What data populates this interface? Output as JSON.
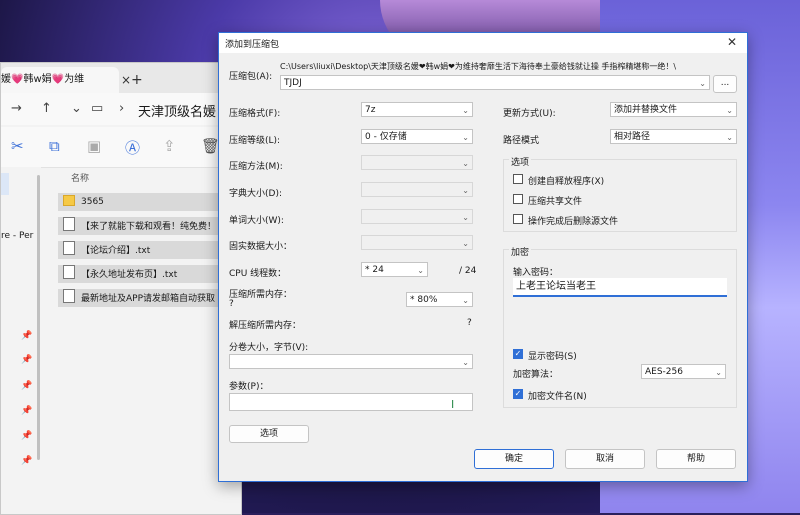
{
  "explorer": {
    "tab_title": "媛💗韩w娟💗为维",
    "path": "天津顶级名媛",
    "column_name": "名称",
    "side_label": "re - Per",
    "files": [
      {
        "name": "3565",
        "type": "folder"
      },
      {
        "name": "【来了就能下载和观看！纯免费！",
        "type": "file"
      },
      {
        "name": "【论坛介绍】.txt",
        "type": "file"
      },
      {
        "name": "【永久地址发布页】.txt",
        "type": "file"
      },
      {
        "name": "最新地址及APP请发邮箱自动获取",
        "type": "file"
      }
    ]
  },
  "dialog": {
    "title": "添加到压缩包",
    "archive_label": "压缩包(A):",
    "archive_path": "C:\\Users\\liuxi\\Desktop\\天津顶级名媛❤韩w娟❤为维持奢靡生活下海待奉土豪给钱就让操 手指榨精堪称一绝！\\",
    "archive_name": "TJDJ",
    "browse_label": "...",
    "format_label": "压缩格式(F):",
    "format_value": "7z",
    "level_label": "压缩等级(L):",
    "level_value": "0 - 仅存储",
    "method_label": "压缩方法(M):",
    "dict_label": "字典大小(D):",
    "word_label": "单词大小(W):",
    "solid_label": "固实数据大小：",
    "threads_label": "CPU 线程数：",
    "threads_value": "* 24",
    "threads_max": "/ 24",
    "mem_label": "压缩所需内存：",
    "mem_q": "?",
    "mem_value": "* 80%",
    "decomp_label": "解压缩所需内存：",
    "decomp_q": "?",
    "split_label": "分卷大小，字节(V):",
    "params_label": "参数(P)：",
    "options_button": "选项",
    "update_label": "更新方式(U):",
    "update_value": "添加并替换文件",
    "pathmode_label": "路径模式",
    "pathmode_value": "相对路径",
    "options_group": "选项",
    "opt_sfx": "创建自释放程序(X)",
    "opt_shared": "压缩共享文件",
    "opt_delete": "操作完成后删除源文件",
    "enc_group": "加密",
    "pwd_label": "输入密码：",
    "pwd_value": "上老王论坛当老王",
    "show_pwd": "显示密码(S)",
    "enc_method_label": "加密算法：",
    "enc_method_value": "AES-256",
    "enc_names": "加密文件名(N)",
    "ok": "确定",
    "cancel": "取消",
    "help": "帮助"
  }
}
